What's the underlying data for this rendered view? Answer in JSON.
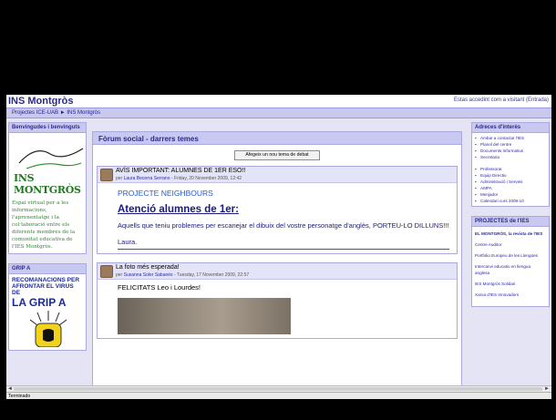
{
  "site": {
    "title": "INS Montgròs",
    "login_info": "Estas accedint com a visitant (Entrada)"
  },
  "breadcrumb": {
    "parent": "Projectes ICE-UAB",
    "separator": "►",
    "current": "INS Montgròs"
  },
  "left": {
    "welcome_block": {
      "heading": "Benvingudes i benvinguts",
      "logo_text": "INS MONTGRÒS",
      "text": "Espai virtual per a les informacions, l'aprenentatge i la col·laboració entre els diferents membres de la comunitat educativa de l'IES Montgròs."
    },
    "grip_block": {
      "heading": "GRIP A",
      "title_small": "RECOMANACIONS PER AFRONTAR EL VIRUS DE",
      "title_big": "LA GRIP A"
    }
  },
  "forum": {
    "heading": "Fòrum social - darrers temes",
    "new_topic_button": "Afegeix un nou tema de debat",
    "posts": [
      {
        "title": "AVÍS IMPORTANT: ALUMNES DE 1ER ESO!!",
        "by": "per",
        "author": "Laura Becerra Serrano",
        "date": "- Friday, 20 November 2009, 12:42",
        "project": "PROJECTE NEIGHBOURS",
        "attention": "Atenció alumnes de 1er:",
        "paragraph": "Aquells que teniu problemes per escanejar el dibuix del vostre personatge d'anglès, PORTEU-LO DILLUNS!!!",
        "signature": "Laura."
      },
      {
        "title": "La foto més esperada!",
        "by": "per",
        "author": "Susanna Soler Sabanés",
        "date": "- Tuesday, 17 November 2009, 22:57",
        "greeting": "FELICITATS Leo i Lourdes!"
      }
    ]
  },
  "right": {
    "links_block": {
      "heading": "Adreces d'interès",
      "links": [
        "Ambar a contactar l'IES",
        "Planol del centre",
        "Documents Informatius",
        "Secretaria",
        "Professorat",
        "Equip Directiu",
        "Administració i Serveis",
        "AMPA",
        "Menjador",
        "Calendari curs 2009-10"
      ]
    },
    "projects_block": {
      "heading": "PROJECTES de l'IES",
      "items": [
        "EL MONTGRÒS, la revista de l'IES",
        "Centre Auditor",
        "Portfolio Europeu de les Llengües",
        "Intercanvi educatiu en llengua anglesa",
        "IES Montgròs Solidari",
        "Xarxa d'IES Innovadors"
      ]
    }
  },
  "status": {
    "text": "Terminado"
  }
}
